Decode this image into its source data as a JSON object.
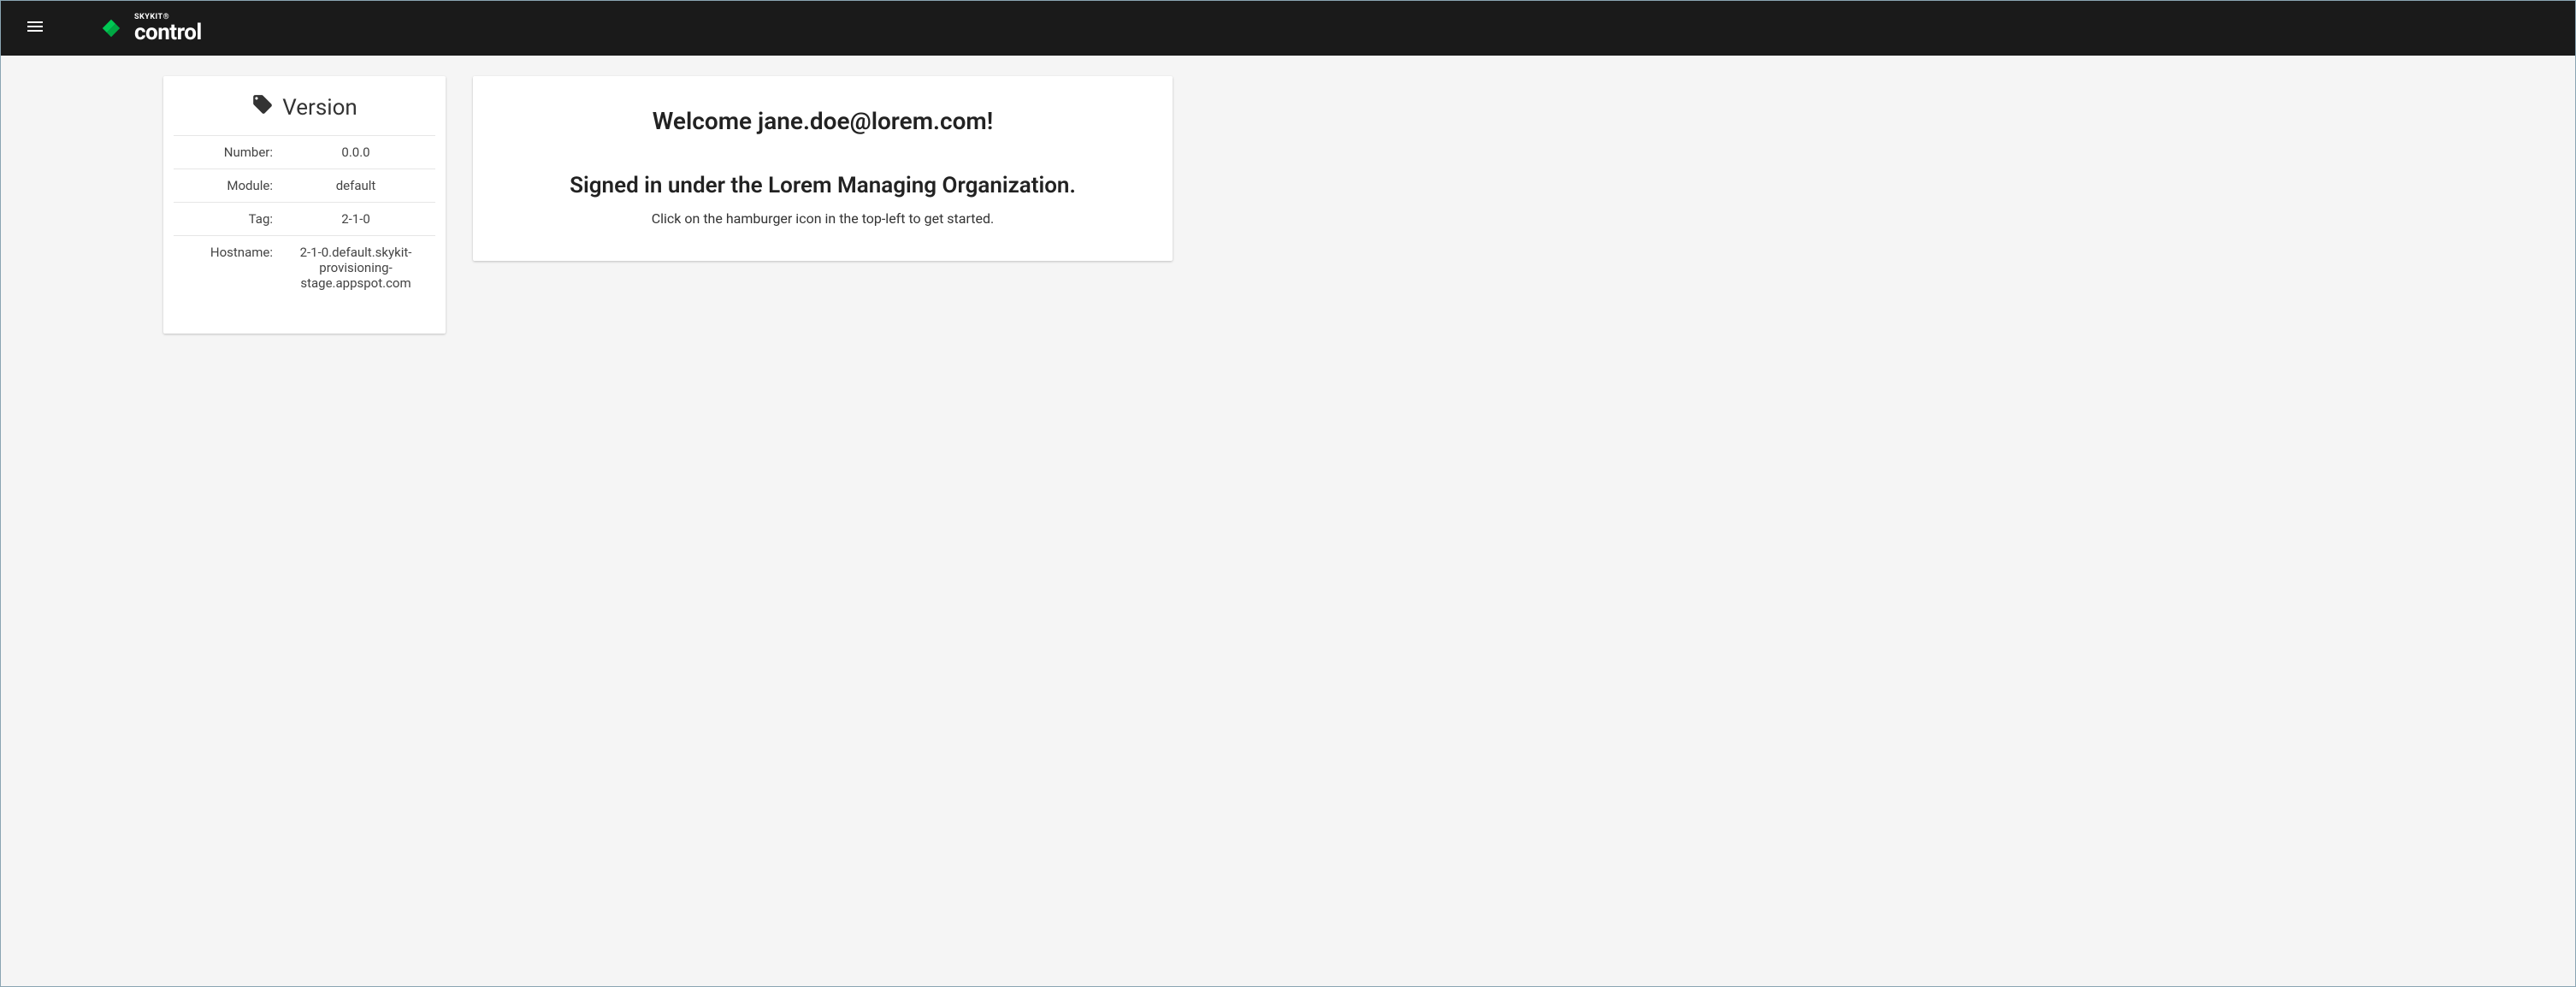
{
  "header": {
    "brand_top": "SKYKIT®",
    "brand_main": "control"
  },
  "version_card": {
    "title": "Version",
    "rows": [
      {
        "label": "Number:",
        "value": "0.0.0"
      },
      {
        "label": "Module:",
        "value": "default"
      },
      {
        "label": "Tag:",
        "value": "2-1-0"
      },
      {
        "label": "Hostname:",
        "value": "2-1-0.default.skykit-provisioning-stage.appspot.com"
      }
    ]
  },
  "welcome_card": {
    "heading": "Welcome jane.doe@lorem.com!",
    "subheading": "Signed in under the Lorem Managing Organization.",
    "hint": "Click on the hamburger icon in the top-left to get started."
  }
}
